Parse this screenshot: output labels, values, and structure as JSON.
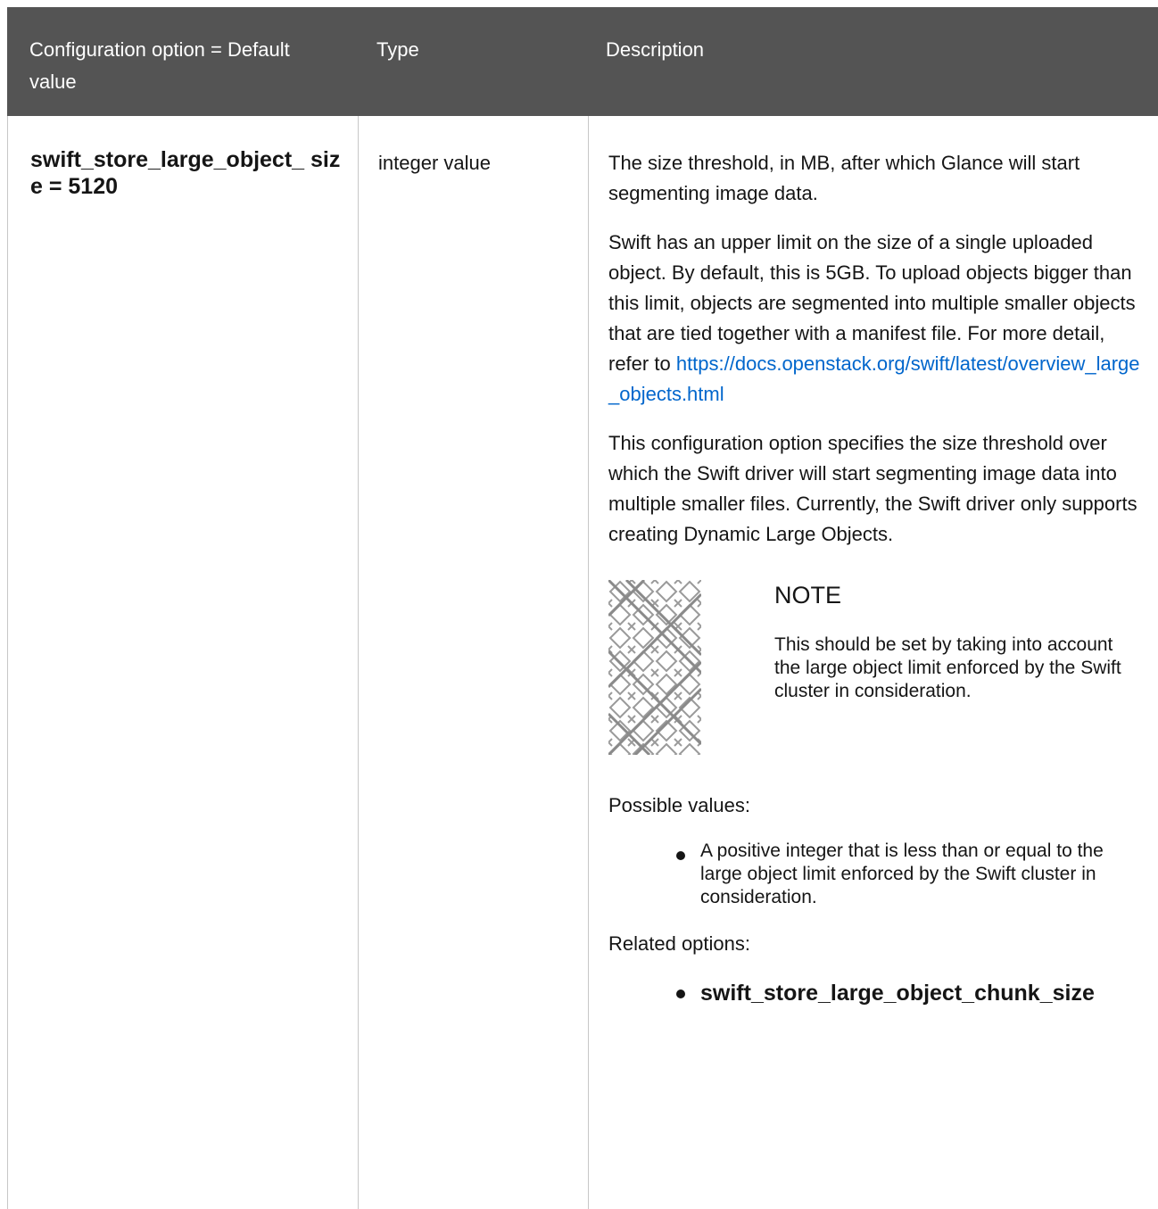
{
  "table": {
    "headers": {
      "option": "Configuration option = Default value",
      "type": "Type",
      "description": "Description"
    },
    "row": {
      "option_name": "swift_store_large_object_ size = 5120",
      "type": "integer value",
      "description": {
        "p1": "The size threshold, in MB, after which Glance will start segmenting image data.",
        "p2_text": "Swift has an upper limit on the size of a single uploaded object. By default, this is 5GB. To upload objects bigger than this limit, objects are segmented into multiple smaller objects that are tied together with a manifest file. For more detail, refer to",
        "p2_link": "https://docs.openstack.org/swift/latest/overview_large_objects.html",
        "p3": "This configuration option specifies the size threshold over which the Swift driver will start segmenting image data into multiple smaller files. Currently, the Swift driver only supports creating Dynamic Large Objects.",
        "note": {
          "title": "NOTE",
          "body": "This should be set by taking into account the large object limit enforced by the Swift cluster in consideration.",
          "icon": "note-pattern-icon"
        },
        "possible_values_label": "Possible values:",
        "possible_values": [
          "A positive integer that is less than or equal to the large object limit enforced by the Swift cluster in consideration."
        ],
        "related_options_label": "Related options:",
        "related_options": [
          "swift_store_large_object_chunk_size"
        ]
      }
    }
  },
  "colors": {
    "header_bg": "#545454",
    "header_text": "#ffffff",
    "link": "#0066cc",
    "border": "#c7c7c7"
  }
}
